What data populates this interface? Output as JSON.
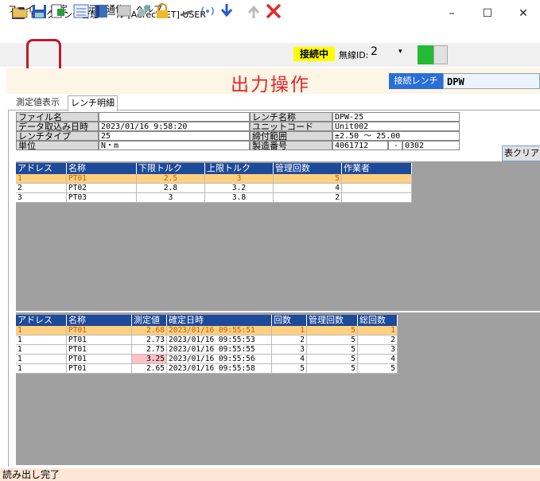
{
  "window": {
    "title": "トルクレンチ管理ツール [Adrec.NET] USER",
    "minimize": "–",
    "maximize": "☐",
    "close": "✕"
  },
  "menu": [
    "ファイル",
    "設定",
    "表示",
    "通信",
    "ヘルプ"
  ],
  "toolbar": {
    "icons": [
      "open-folder-icon",
      "save-icon",
      "export-icon",
      "list-icon",
      "book-icon",
      "display-icon",
      "settings-icon",
      "lock-icon",
      "wrench-icon",
      "wireless-icon",
      "download-icon",
      "upload-icon",
      "delete-icon"
    ],
    "status_label": "接続中",
    "wireless_label": "無線ID:",
    "wireless_id": "2",
    "status_color": "#22bb33"
  },
  "header": {
    "title": "出力操作",
    "connected_label": "接続レンチ",
    "connected_value": "DPW"
  },
  "tabs": [
    "測定値表示",
    "レンチ明細"
  ],
  "info": {
    "file_label": "ファイル名",
    "file_value": "",
    "wrench_name_label": "レンチ名称",
    "wrench_name_value": "DPW-25",
    "import_date_label": "データ取込み日時",
    "import_date_value": "2023/01/16 9:58:20",
    "unit_code_label": "ユニットコード",
    "unit_code_value": "Unit002",
    "wrench_type_label": "レンチタイプ",
    "wrench_type_value": "25",
    "range_label": "締付範囲",
    "range_value": "±2.50 ～ 25.00",
    "unit_label": "単位",
    "unit_value": "N・m",
    "serial_label": "製造番号",
    "serial_value": "4061712",
    "serial_sep": "-",
    "serial_suffix": "0302",
    "clear_button": "表クリア"
  },
  "upper_grid": {
    "headers": [
      "アドレス",
      "名称",
      "下限トルク",
      "上限トルク",
      "管理回数",
      "作業者"
    ],
    "rows": [
      [
        "1",
        "PT01",
        "2.5",
        "3",
        "5",
        ""
      ],
      [
        "2",
        "PT02",
        "2.8",
        "3.2",
        "4",
        ""
      ],
      [
        "3",
        "PT03",
        "3",
        "3.8",
        "2",
        ""
      ]
    ]
  },
  "lower_grid": {
    "headers": [
      "アドレス",
      "名称",
      "測定値",
      "確定日時",
      "回数",
      "管理回数",
      "総回数"
    ],
    "rows": [
      [
        "1",
        "PT01",
        "2.68",
        "2023/01/16 09:55:51",
        "1",
        "5",
        "1"
      ],
      [
        "1",
        "PT01",
        "2.73",
        "2023/01/16 09:55:53",
        "2",
        "5",
        "2"
      ],
      [
        "1",
        "PT01",
        "2.75",
        "2023/01/16 09:55:55",
        "3",
        "5",
        "3"
      ],
      [
        "1",
        "PT01",
        "3.25",
        "2023/01/16 09:55:56",
        "4",
        "5",
        "4"
      ],
      [
        "1",
        "PT01",
        "2.65",
        "2023/01/16 09:55:58",
        "5",
        "5",
        "5"
      ]
    ]
  },
  "status": "読み出し完了"
}
